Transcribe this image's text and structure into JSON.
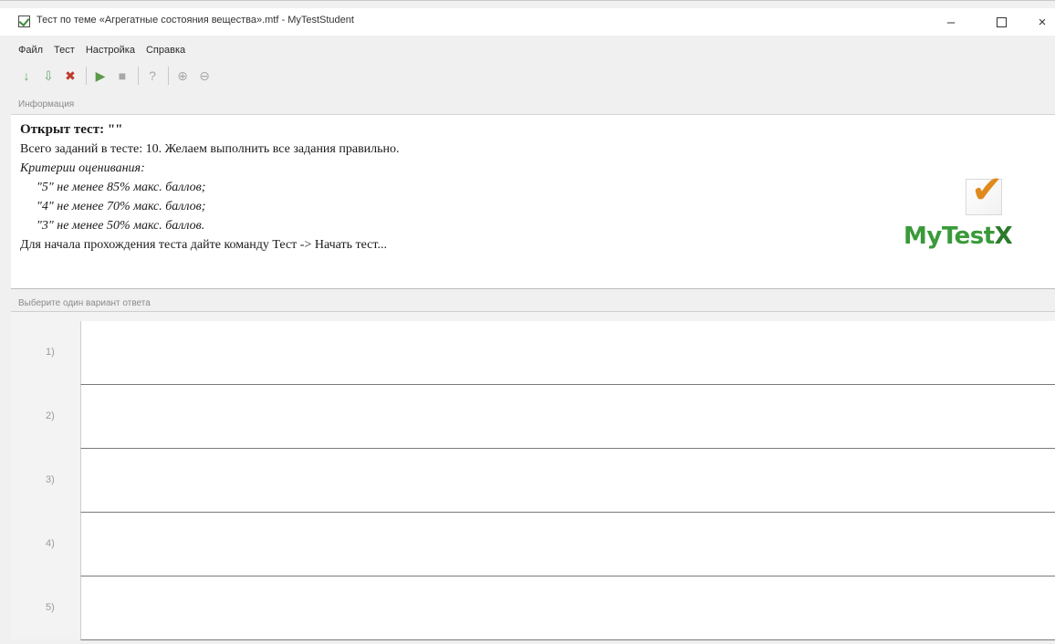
{
  "window": {
    "title": "Тест по теме «Агрегатные состояния вещества».mtf - MyTestStudent",
    "minimize_glyph": "–",
    "close_glyph": "×"
  },
  "menu": {
    "items": [
      "Файл",
      "Тест",
      "Настройка",
      "Справка"
    ]
  },
  "toolbar": {
    "buttons": [
      {
        "icon": "open-down-arrow-icon",
        "glyph": "↓"
      },
      {
        "icon": "save-down-arrow-icon",
        "glyph": "⇩"
      },
      {
        "icon": "close-test-icon",
        "glyph": "✖"
      },
      {
        "icon": "start-test-icon",
        "glyph": "▶"
      },
      {
        "icon": "stop-icon",
        "glyph": "■"
      },
      {
        "icon": "help-icon",
        "glyph": "?"
      },
      {
        "icon": "zoom-in-icon",
        "glyph": "⊕"
      },
      {
        "icon": "zoom-out-icon",
        "glyph": "⊖"
      }
    ]
  },
  "info": {
    "caption": "Информация",
    "opened_test": "Открыт тест: \"\"",
    "tasks_line": "Всего заданий в тесте: 10. Желаем выполнить все задания правильно.",
    "criteria_heading": "Критерии оценивания:",
    "criteria": [
      "\"5\" не менее 85% макс. баллов;",
      "\"4\" не менее 70% макс. баллов;",
      "\"3\" не менее 50% макс. баллов."
    ],
    "start_line": "Для начала прохождения теста дайте команду Тест -> Начать тест..."
  },
  "logo": {
    "brand_main": "MyTest",
    "brand_x": "X",
    "check_glyph": "✔",
    "brand_color": "#3a9a3a",
    "check_color": "#e08a1e"
  },
  "answers": {
    "caption": "Выберите один вариант ответа",
    "rows": [
      {
        "label": "1)",
        "text": ""
      },
      {
        "label": "2)",
        "text": ""
      },
      {
        "label": "3)",
        "text": ""
      },
      {
        "label": "4)",
        "text": ""
      },
      {
        "label": "5)",
        "text": ""
      }
    ]
  }
}
